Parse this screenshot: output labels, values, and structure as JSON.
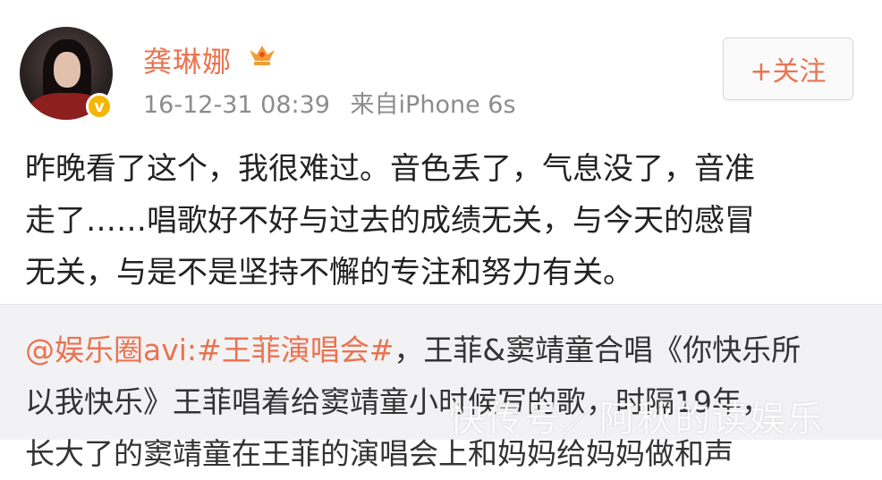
{
  "post": {
    "username": "龚琳娜",
    "timestamp": "16-12-31 08:39",
    "source": "来自iPhone 6s",
    "follow_label": "+关注",
    "verified_badge": "v",
    "avatar_icon": "user-avatar",
    "crown_icon": "vip-crown-icon",
    "content_lines": [
      "昨晚看了这个，我很难过。音色丢了，气息没了，音准",
      "走了……唱歌好不好与过去的成绩无关，与今天的感冒",
      "无关，与是不是坚持不懈的专注和努力有关。"
    ]
  },
  "repost": {
    "mention": "@娱乐圈avi",
    "colon": ":",
    "topic": "#王菲演唱会#",
    "line1_rest": "，王菲&窦靖童合唱《你快乐所",
    "line2": "以我快乐》王菲唱着给窦靖童小时候写的歌，时隔19年，",
    "line3": "长大了的窦靖童在王菲的演唱会上和妈妈给妈妈做和声"
  },
  "watermark": "快传号／阿秋的读娱乐",
  "colors": {
    "accent": "#eb7350",
    "meta_gray": "#8c8c8c",
    "repost_bg": "#f2f2f4",
    "verified": "#f5b500"
  }
}
